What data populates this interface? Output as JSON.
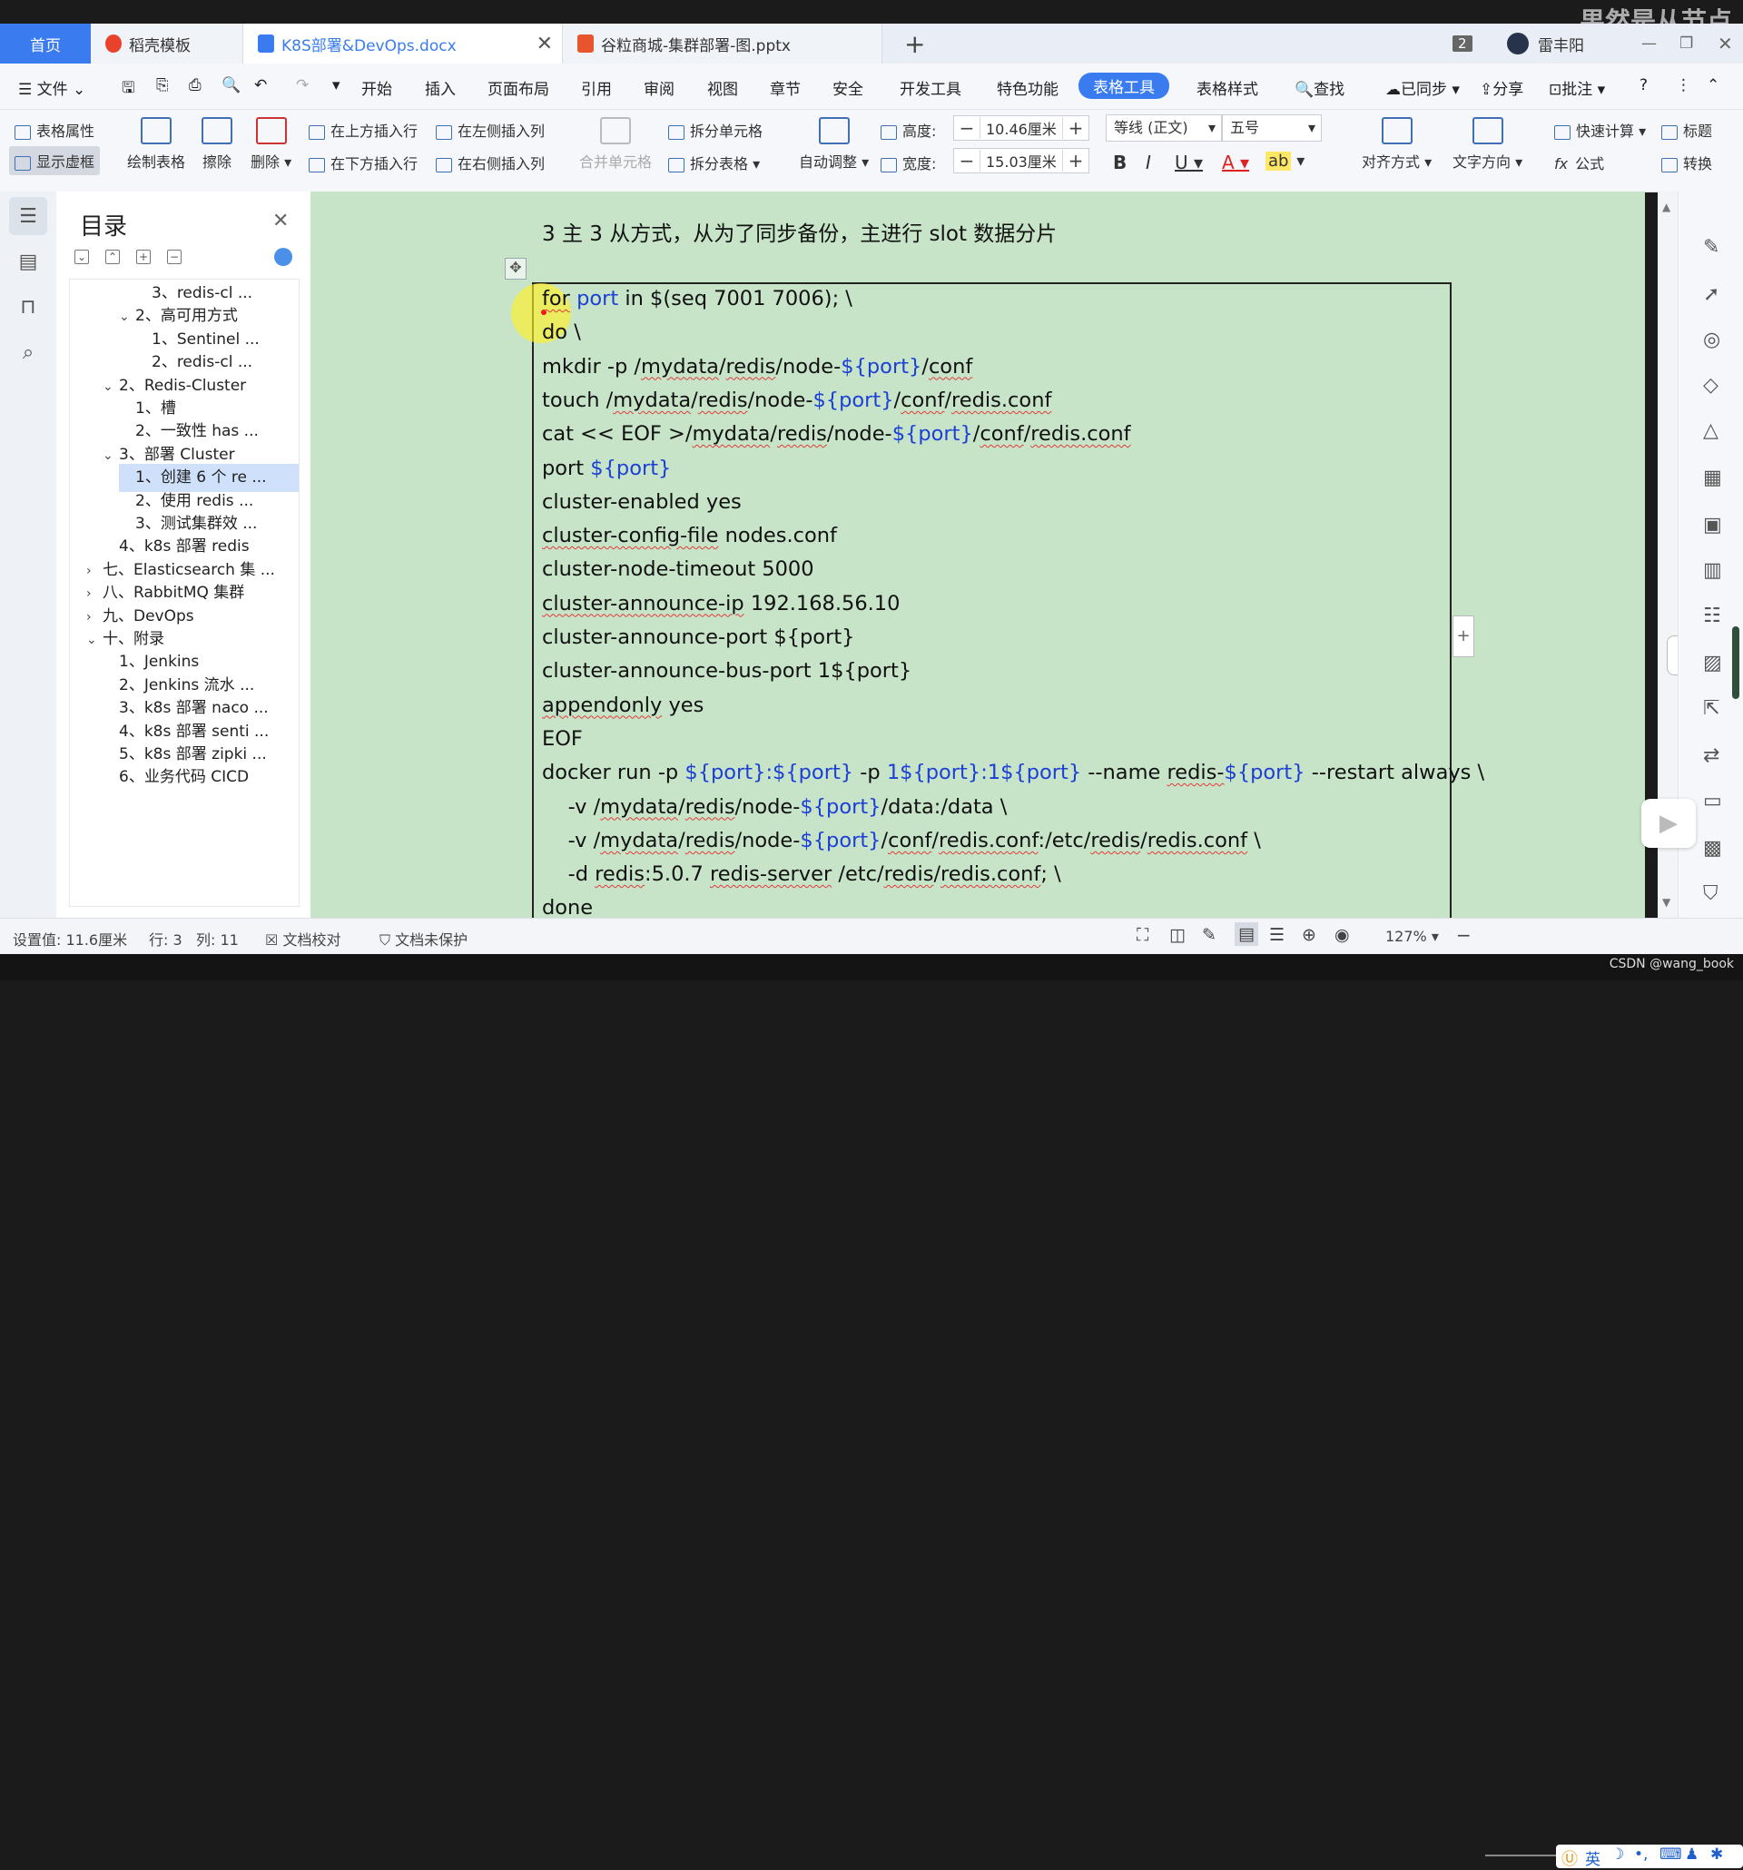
{
  "watermark_top": "果然是从节点",
  "watermark_bottom": "CSDN @wang_book",
  "tabs": [
    {
      "label": "首页"
    },
    {
      "label": "稻壳模板"
    },
    {
      "label": "K8S部署&DevOps.docx"
    },
    {
      "label": "谷粒商城-集群部署-图.pptx"
    }
  ],
  "tabbar_right": {
    "badge": "2",
    "user": "雷丰阳"
  },
  "menu": {
    "file": "文件",
    "items": [
      "开始",
      "插入",
      "页面布局",
      "引用",
      "审阅",
      "视图",
      "章节",
      "安全",
      "开发工具",
      "特色功能",
      "表格工具",
      "表格样式"
    ],
    "active": "表格工具",
    "search": "查找",
    "synced": "已同步",
    "share": "分享",
    "comment": "批注"
  },
  "ribbon": {
    "table_props": "表格属性",
    "show_dashed": "显示虚框",
    "draw_table": "绘制表格",
    "erase": "擦除",
    "delete": "删除",
    "insert_above": "在上方插入行",
    "insert_below": "在下方插入行",
    "insert_left": "在左侧插入列",
    "insert_right": "在右侧插入列",
    "merge_cells": "合并单元格",
    "split_cell": "拆分单元格",
    "split_table": "拆分表格",
    "auto_adjust": "自动调整",
    "height_label": "高度:",
    "height_value": "10.46厘米",
    "width_label": "宽度:",
    "width_value": "15.03厘米",
    "font": "等线 (正文)",
    "font_size": "五号",
    "align": "对齐方式",
    "text_dir": "文字方向",
    "quick_calc": "快速计算",
    "formula": "公式",
    "title_row": "标题",
    "convert": "转换"
  },
  "toc": {
    "title": "目录",
    "items": [
      {
        "label": "3、redis-cl ...",
        "level": 3
      },
      {
        "label": "2、高可用方式",
        "level": 2,
        "expanded": true
      },
      {
        "label": "1、Sentinel ...",
        "level": 3
      },
      {
        "label": "2、redis-cl ...",
        "level": 3
      },
      {
        "label": "2、Redis-Cluster",
        "level": 1,
        "expanded": true
      },
      {
        "label": "1、槽",
        "level": 2
      },
      {
        "label": "2、一致性 has ...",
        "level": 2
      },
      {
        "label": "3、部署 Cluster",
        "level": 1,
        "expanded": true
      },
      {
        "label": "1、创建 6 个 re ...",
        "level": 2,
        "selected": true
      },
      {
        "label": "2、使用 redis ...",
        "level": 2
      },
      {
        "label": "3、测试集群效 ...",
        "level": 2
      },
      {
        "label": "4、k8s 部署 redis",
        "level": 1
      },
      {
        "label": "七、Elasticsearch 集 ...",
        "level": 0,
        "collapsed": true
      },
      {
        "label": "八、RabbitMQ 集群",
        "level": 0,
        "collapsed": true
      },
      {
        "label": "九、DevOps",
        "level": 0,
        "collapsed": true
      },
      {
        "label": "十、附录",
        "level": 0,
        "expanded": true
      },
      {
        "label": "1、Jenkins",
        "level": 1
      },
      {
        "label": "2、Jenkins 流水 ...",
        "level": 1
      },
      {
        "label": "3、k8s 部署 naco ...",
        "level": 1
      },
      {
        "label": "4、k8s 部署 senti ...",
        "level": 1
      },
      {
        "label": "5、k8s 部署 zipki ...",
        "level": 1
      },
      {
        "label": "6、业务代码 CICD",
        "level": 1
      }
    ]
  },
  "doc": {
    "heading": "3 主 3 从方式，从为了同步备份，主进行 slot 数据分片",
    "code_lines": [
      [
        {
          "t": "for",
          "s": "u"
        },
        {
          "t": " "
        },
        {
          "t": "port",
          "c": "v"
        },
        {
          "t": " in $(seq 7001 7006); \\"
        }
      ],
      [
        {
          "t": "do \\"
        }
      ],
      [
        {
          "t": "mkdir -p /"
        },
        {
          "t": "mydata",
          "s": "u"
        },
        {
          "t": "/"
        },
        {
          "t": "redis",
          "s": "u"
        },
        {
          "t": "/node-"
        },
        {
          "t": "${port}",
          "c": "v"
        },
        {
          "t": "/"
        },
        {
          "t": "conf",
          "s": "u"
        }
      ],
      [
        {
          "t": "touch /"
        },
        {
          "t": "mydata",
          "s": "u"
        },
        {
          "t": "/"
        },
        {
          "t": "redis",
          "s": "u"
        },
        {
          "t": "/node-"
        },
        {
          "t": "${port}",
          "c": "v"
        },
        {
          "t": "/"
        },
        {
          "t": "conf",
          "s": "u"
        },
        {
          "t": "/"
        },
        {
          "t": "redis.conf",
          "s": "u"
        }
      ],
      [
        {
          "t": "cat << EOF >/"
        },
        {
          "t": "mydata",
          "s": "u"
        },
        {
          "t": "/"
        },
        {
          "t": "redis",
          "s": "u"
        },
        {
          "t": "/node-"
        },
        {
          "t": "${port}",
          "c": "v"
        },
        {
          "t": "/"
        },
        {
          "t": "conf",
          "s": "u"
        },
        {
          "t": "/"
        },
        {
          "t": "redis.conf",
          "s": "u"
        }
      ],
      [
        {
          "t": "port "
        },
        {
          "t": "${port}",
          "c": "v"
        }
      ],
      [
        {
          "t": "cluster-enabled yes"
        }
      ],
      [
        {
          "t": "cluster-config-file",
          "s": "u"
        },
        {
          "t": " nodes.conf"
        }
      ],
      [
        {
          "t": "cluster-node-timeout 5000"
        }
      ],
      [
        {
          "t": "cluster-announce-ip",
          "s": "u"
        },
        {
          "t": " 192.168.56.10"
        }
      ],
      [
        {
          "t": "cluster-announce-port ${port}"
        }
      ],
      [
        {
          "t": "cluster-announce-bus-port 1${port}"
        }
      ],
      [
        {
          "t": "appendonly",
          "s": "u"
        },
        {
          "t": " yes"
        }
      ],
      [
        {
          "t": "EOF"
        }
      ],
      [
        {
          "t": "docker run -p "
        },
        {
          "t": "${port}:${port}",
          "c": "v"
        },
        {
          "t": " -p "
        },
        {
          "t": "1${port}:1${port}",
          "c": "v"
        },
        {
          "t": " --name "
        },
        {
          "t": "redis-",
          "s": "u"
        },
        {
          "t": "${port}",
          "c": "v"
        },
        {
          "t": " --restart always \\"
        }
      ],
      [
        {
          "t": "    -v /"
        },
        {
          "t": "mydata",
          "s": "u"
        },
        {
          "t": "/"
        },
        {
          "t": "redis",
          "s": "u"
        },
        {
          "t": "/node-"
        },
        {
          "t": "${port}",
          "c": "v"
        },
        {
          "t": "/data:/data \\"
        }
      ],
      [
        {
          "t": "    -v /"
        },
        {
          "t": "mydata",
          "s": "u"
        },
        {
          "t": "/"
        },
        {
          "t": "redis",
          "s": "u"
        },
        {
          "t": "/node-"
        },
        {
          "t": "${port}",
          "c": "v"
        },
        {
          "t": "/"
        },
        {
          "t": "conf",
          "s": "u"
        },
        {
          "t": "/"
        },
        {
          "t": "redis.conf",
          "s": "u"
        },
        {
          "t": ":/etc/"
        },
        {
          "t": "redis",
          "s": "u"
        },
        {
          "t": "/"
        },
        {
          "t": "redis.conf",
          "s": "u"
        },
        {
          "t": " \\"
        }
      ],
      [
        {
          "t": "    -d "
        },
        {
          "t": "redis",
          "s": "u"
        },
        {
          "t": ":5.0.7 "
        },
        {
          "t": "redis-server",
          "s": "u"
        },
        {
          "t": " /etc/"
        },
        {
          "t": "redis",
          "s": "u"
        },
        {
          "t": "/"
        },
        {
          "t": "redis.conf",
          "s": "u"
        },
        {
          "t": "; \\"
        }
      ],
      [
        {
          "t": "done"
        }
      ]
    ]
  },
  "status": {
    "setting": "设置值: 11.6厘米",
    "row": "行: 3",
    "col": "列: 11",
    "proof": "文档校对",
    "protect": "文档未保护",
    "zoom": "127%",
    "ime": "英"
  },
  "colors": {
    "accent": "#3a7cf0",
    "code_var": "#1c3fd6",
    "page_bg": "#cfe8d0"
  }
}
